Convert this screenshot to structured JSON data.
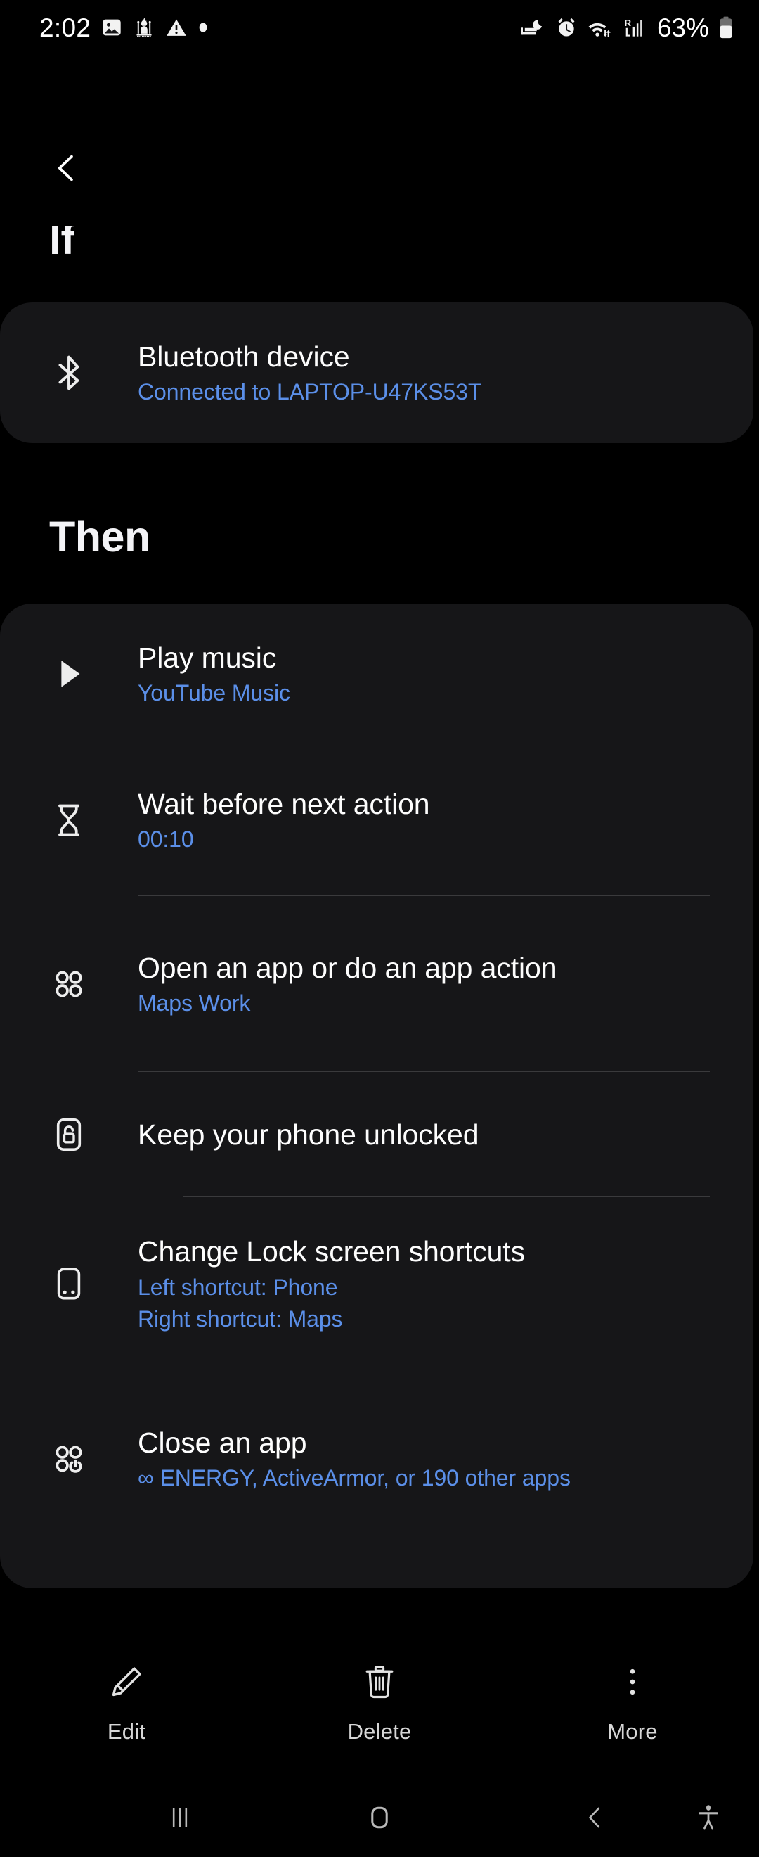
{
  "status_bar": {
    "time": "2:02",
    "battery_percent": "63%",
    "left_icons": [
      "image-icon",
      "mosque-icon",
      "warning-icon",
      "dot-icon"
    ],
    "right_icons": [
      "bedtime-icon",
      "alarm-icon",
      "wifi-icon",
      "roaming-signal-icon",
      "battery-icon"
    ]
  },
  "nav": {
    "back_label": "back-arrow"
  },
  "sections": {
    "if": {
      "heading": "If",
      "items": [
        {
          "icon": "bluetooth-icon",
          "title": "Bluetooth device",
          "subtitle": "Connected to LAPTOP-U47KS53T"
        }
      ]
    },
    "then": {
      "heading": "Then",
      "items": [
        {
          "icon": "play-icon",
          "title": "Play music",
          "subtitle": "YouTube Music"
        },
        {
          "icon": "hourglass-icon",
          "title": "Wait before next action",
          "subtitle": "00:10"
        },
        {
          "icon": "app-grid-icon",
          "title": "Open an app or do an app action",
          "subtitle": "Maps Work"
        },
        {
          "icon": "phone-unlocked-icon",
          "title": "Keep your phone unlocked",
          "subtitle": ""
        },
        {
          "icon": "lock-screen-shortcuts-icon",
          "title": "Change Lock screen shortcuts",
          "subtitle": "Left shortcut: Phone",
          "subtitle2": "Right shortcut: Maps"
        },
        {
          "icon": "close-app-icon",
          "title": "Close an app",
          "subtitle": "∞ ENERGY, ActiveArmor, or 190 other apps"
        }
      ]
    }
  },
  "action_bar": {
    "edit_label": "Edit",
    "delete_label": "Delete",
    "more_label": "More"
  },
  "system_nav": {
    "recents": "recents-icon",
    "home": "home-icon",
    "back": "back-icon",
    "accessibility": "accessibility-icon"
  },
  "colors": {
    "background": "#000000",
    "card": "#161618",
    "accent_blue": "#5b8fe8",
    "primary_text": "#fdfdfd",
    "divider": "#3a3a3c"
  }
}
